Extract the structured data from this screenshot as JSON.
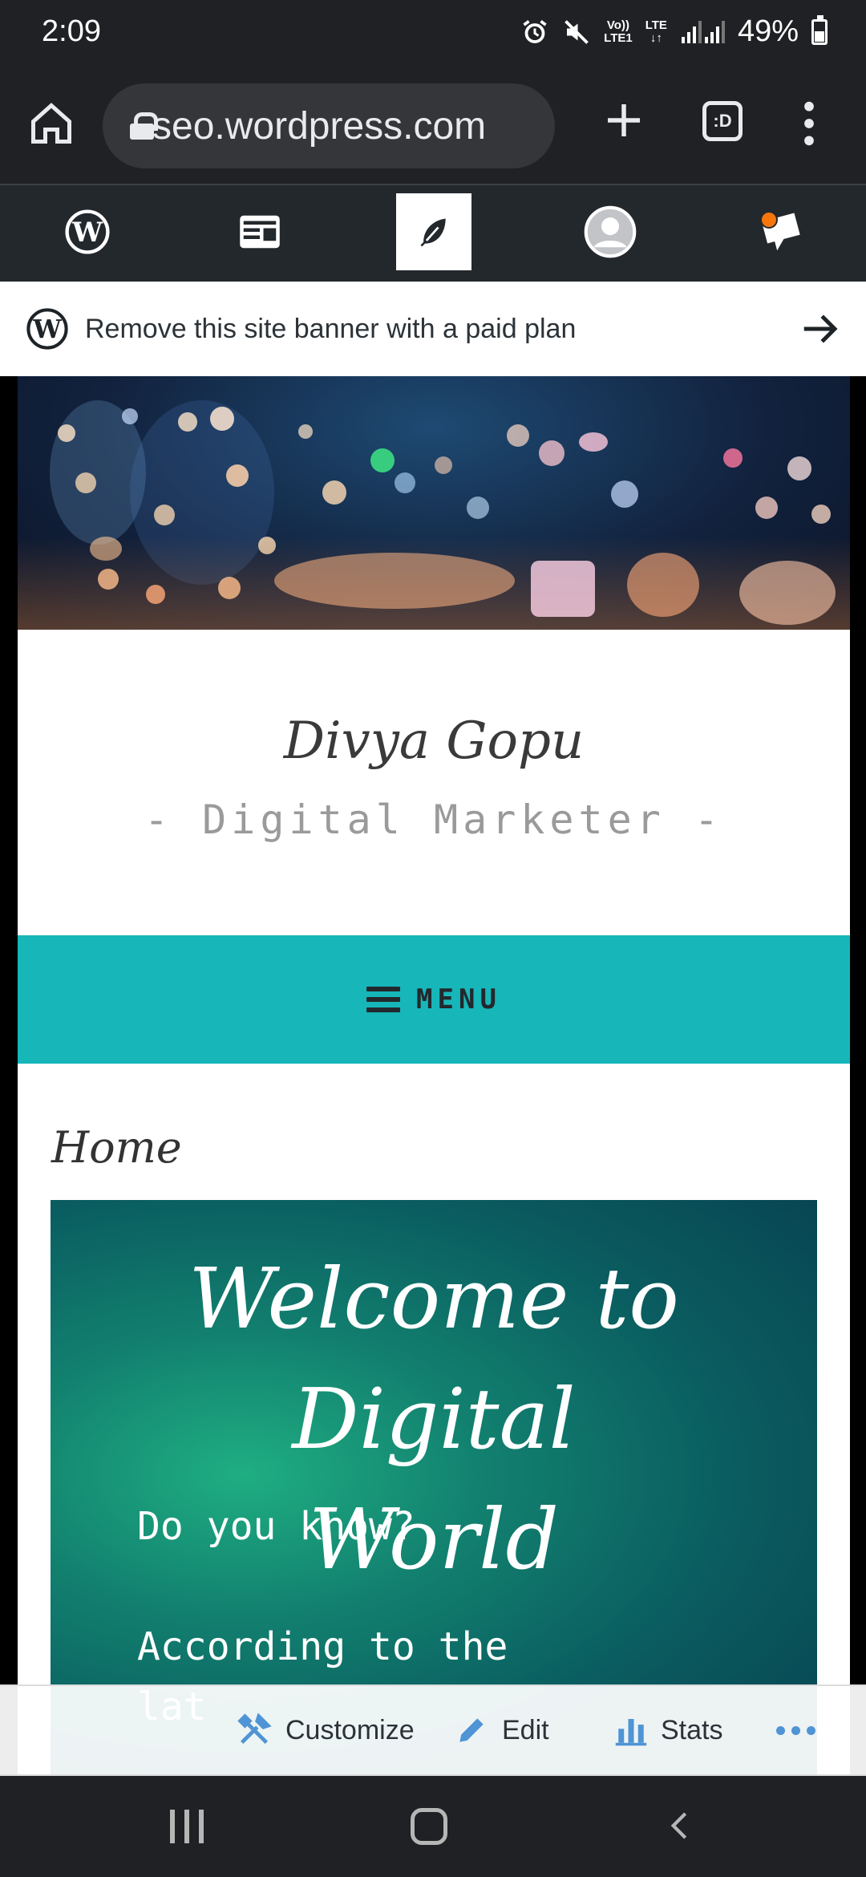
{
  "status_bar": {
    "time": "2:09",
    "net_top": "Vo))",
    "net_bottom": "LTE1",
    "lte_top": "LTE",
    "lte_arrows": "↓↑",
    "battery": "49%"
  },
  "browser": {
    "url": "seo.wordpress.com",
    "tabs_label": ":D"
  },
  "wp_admin_bar": {
    "items": [
      "wordpress-logo",
      "reader",
      "write",
      "profile",
      "notifications"
    ],
    "active_color": "#ffffff",
    "notification_color": "#f6760c"
  },
  "banner": {
    "text": "Remove this site banner with a paid plan"
  },
  "site": {
    "title": "Divya Gopu",
    "description": "- Digital Marketer -",
    "menu_label": "MENU",
    "accent_color": "#17b6b9"
  },
  "content": {
    "heading": "Home",
    "welcome_title": "Welcome to Digital World",
    "welcome_lines": [
      "Do you know?",
      "",
      "According to the",
      "lat"
    ]
  },
  "actions": {
    "customize": "Customize",
    "edit": "Edit",
    "stats": "Stats"
  }
}
